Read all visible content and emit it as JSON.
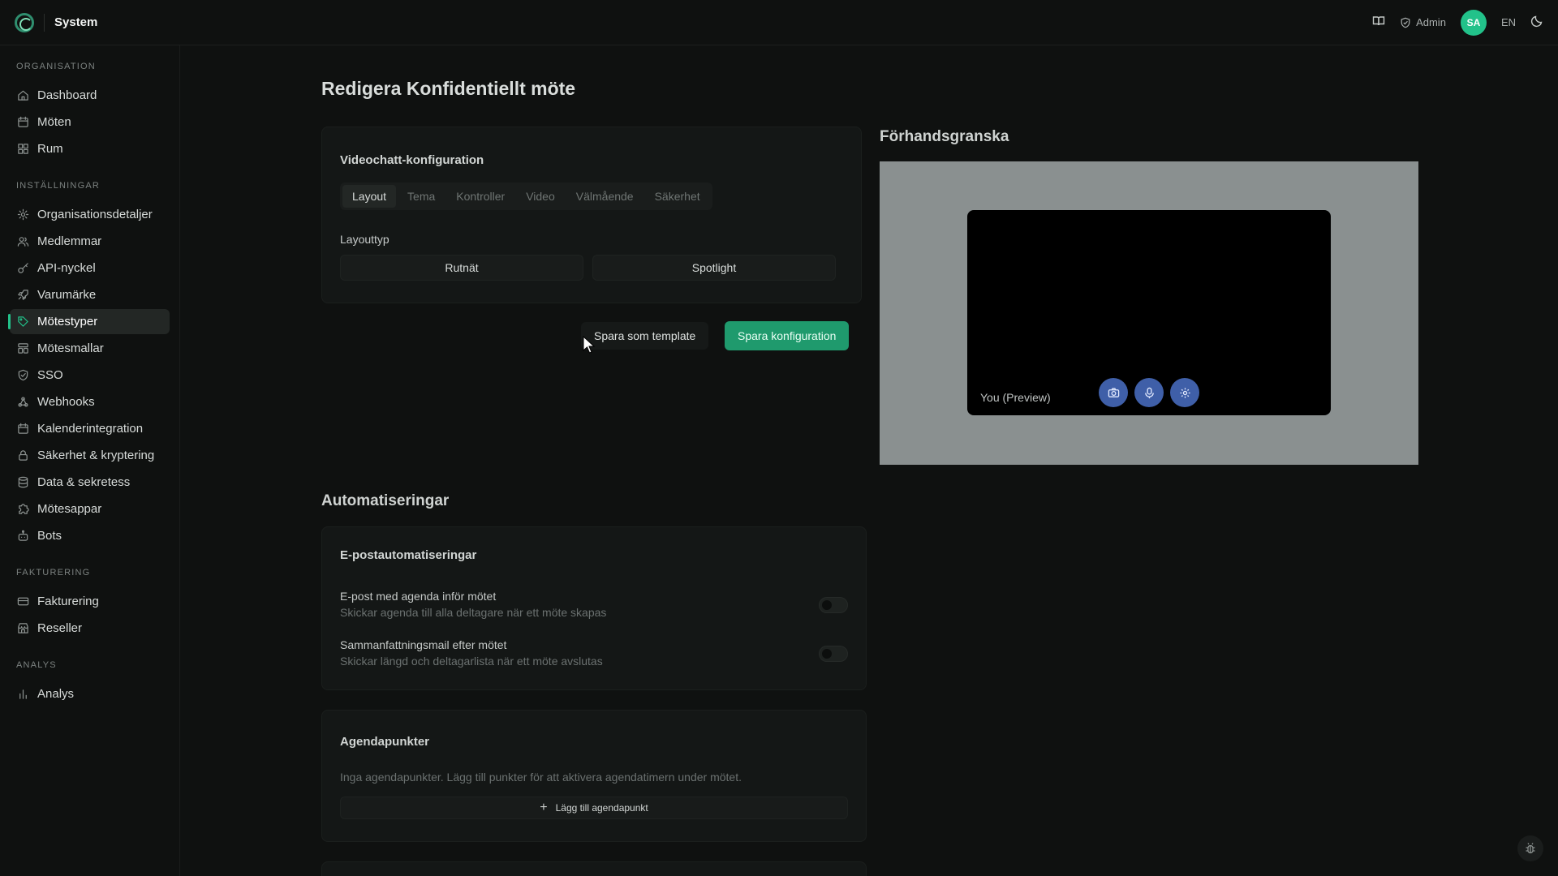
{
  "app": {
    "title": "System"
  },
  "topbar": {
    "admin_label": "Admin",
    "avatar_initials": "SA",
    "language": "EN"
  },
  "sidebar": {
    "sections": [
      {
        "label": "ORGANISATION",
        "items": [
          {
            "label": "Dashboard",
            "icon": "home-icon"
          },
          {
            "label": "Möten",
            "icon": "calendar-icon"
          },
          {
            "label": "Rum",
            "icon": "grid-icon"
          }
        ]
      },
      {
        "label": "INSTÄLLNINGAR",
        "items": [
          {
            "label": "Organisationsdetaljer",
            "icon": "gear-icon"
          },
          {
            "label": "Medlemmar",
            "icon": "users-icon"
          },
          {
            "label": "API-nyckel",
            "icon": "key-icon"
          },
          {
            "label": "Varumärke",
            "icon": "rocket-icon"
          },
          {
            "label": "Mötestyper",
            "icon": "tag-icon",
            "active": true
          },
          {
            "label": "Mötesmallar",
            "icon": "template-icon"
          },
          {
            "label": "SSO",
            "icon": "shield-icon"
          },
          {
            "label": "Webhooks",
            "icon": "webhook-icon"
          },
          {
            "label": "Kalenderintegration",
            "icon": "calendar-icon"
          },
          {
            "label": "Säkerhet & kryptering",
            "icon": "lock-icon"
          },
          {
            "label": "Data & sekretess",
            "icon": "database-icon"
          },
          {
            "label": "Mötesappar",
            "icon": "puzzle-icon"
          },
          {
            "label": "Bots",
            "icon": "bot-icon"
          }
        ]
      },
      {
        "label": "FAKTURERING",
        "items": [
          {
            "label": "Fakturering",
            "icon": "credit-card-icon"
          },
          {
            "label": "Reseller",
            "icon": "store-icon"
          }
        ]
      },
      {
        "label": "ANALYS",
        "items": [
          {
            "label": "Analys",
            "icon": "bar-chart-icon"
          }
        ]
      }
    ]
  },
  "page": {
    "title": "Redigera Konfidentiellt möte"
  },
  "video_config": {
    "title": "Videochatt-konfiguration",
    "tabs": [
      "Layout",
      "Tema",
      "Kontroller",
      "Video",
      "Välmående",
      "Säkerhet"
    ],
    "active_tab": 0,
    "layout_label": "Layouttyp",
    "layout_options": [
      "Rutnät",
      "Spotlight"
    ],
    "save_template": "Spara som template",
    "save_config": "Spara konfiguration"
  },
  "preview": {
    "title": "Förhandsgranska",
    "you_label": "You (Preview)"
  },
  "automations": {
    "title": "Automatiseringar",
    "email_title": "E-postautomatiseringar",
    "rows": [
      {
        "title": "E-post med agenda inför mötet",
        "desc": "Skickar agenda till alla deltagare när ett möte skapas"
      },
      {
        "title": "Sammanfattningsmail efter mötet",
        "desc": "Skickar längd och deltagarlista när ett möte avslutas"
      }
    ]
  },
  "agenda": {
    "title": "Agendapunkter",
    "empty_text": "Inga agendapunkter. Lägg till punkter för att aktivera agendatimern under mötet.",
    "add_label": "Lägg till agendapunkt"
  },
  "colors": {
    "accent": "#22c28a",
    "primary_button": "#1f9a6d",
    "control_button": "#3f5fa8"
  }
}
